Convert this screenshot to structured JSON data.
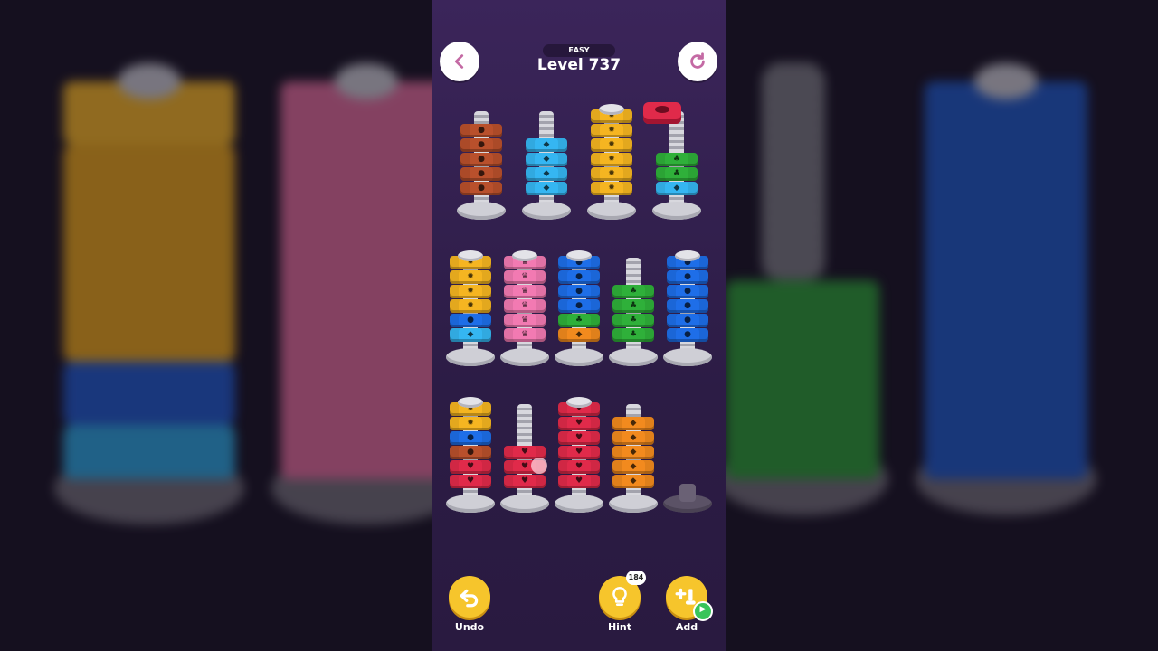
{
  "header": {
    "difficulty": "EASY",
    "level": "Level 737",
    "back_icon": "chevron-left-icon",
    "restart_icon": "restart-icon"
  },
  "colors": {
    "brown": "#b9502c",
    "cyan": "#35b6f2",
    "yellow": "#f5b521",
    "green": "#2fb03a",
    "blue": "#1e6ee8",
    "pink": "#f27ab2",
    "red": "#e02a4a",
    "orange": "#f28a1e"
  },
  "rows": [
    [
      {
        "id": "bolt-1",
        "nuts": [
          "brown",
          "brown",
          "brown",
          "brown",
          "brown"
        ],
        "capped": false
      },
      {
        "id": "bolt-2",
        "nuts": [
          "cyan",
          "cyan",
          "cyan",
          "cyan"
        ],
        "capped": false
      },
      {
        "id": "bolt-3",
        "nuts": [
          "yellow",
          "yellow",
          "yellow",
          "yellow",
          "yellow",
          "yellow"
        ],
        "capped": true
      },
      {
        "id": "bolt-4",
        "nuts": [
          "cyan",
          "green",
          "green"
        ],
        "capped": false,
        "lifted_nut": "red"
      }
    ],
    [
      {
        "id": "bolt-5",
        "nuts": [
          "cyan",
          "blue",
          "yellow",
          "yellow",
          "yellow",
          "yellow"
        ],
        "capped": true
      },
      {
        "id": "bolt-6",
        "nuts": [
          "pink",
          "pink",
          "pink",
          "pink",
          "pink",
          "pink"
        ],
        "capped": true
      },
      {
        "id": "bolt-7",
        "nuts": [
          "orange",
          "green",
          "blue",
          "blue",
          "blue",
          "blue"
        ],
        "capped": true
      },
      {
        "id": "bolt-8",
        "nuts": [
          "green",
          "green",
          "green",
          "green"
        ],
        "capped": false
      },
      {
        "id": "bolt-9",
        "nuts": [
          "blue",
          "blue",
          "blue",
          "blue",
          "blue",
          "blue"
        ],
        "capped": true
      }
    ],
    [
      {
        "id": "bolt-10",
        "nuts": [
          "red",
          "red",
          "brown",
          "blue",
          "yellow",
          "yellow"
        ],
        "capped": true
      },
      {
        "id": "bolt-11",
        "nuts": [
          "red",
          "red",
          "red"
        ],
        "capped": false
      },
      {
        "id": "bolt-12",
        "nuts": [
          "red",
          "red",
          "red",
          "red",
          "red",
          "red"
        ],
        "capped": true
      },
      {
        "id": "bolt-13",
        "nuts": [
          "orange",
          "orange",
          "orange",
          "orange",
          "orange"
        ],
        "capped": false
      },
      {
        "id": "bolt-14",
        "nuts": [],
        "capped": false,
        "empty": true
      }
    ]
  ],
  "toolbar": {
    "undo_label": "Undo",
    "hint_label": "Hint",
    "hint_count": "184",
    "add_label": "Add"
  }
}
